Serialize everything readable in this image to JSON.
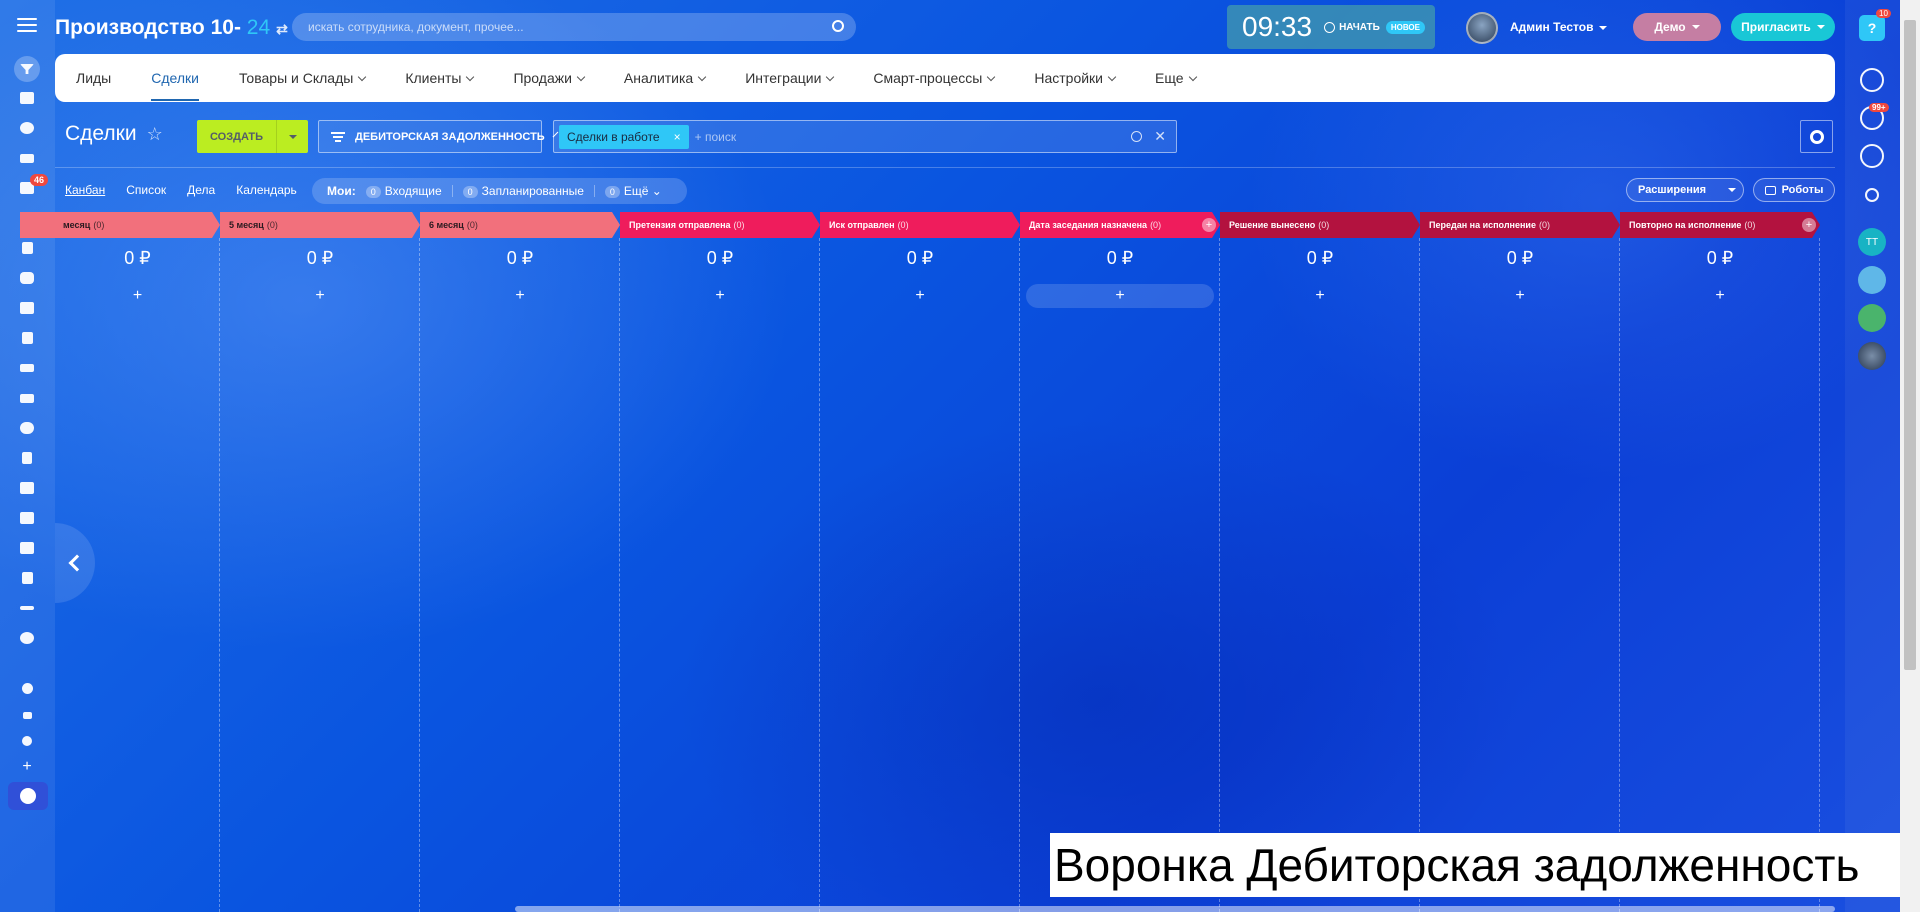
{
  "portal": {
    "title": "Производство 10-",
    "number": "24",
    "swap_icon": "⇄"
  },
  "search": {
    "placeholder": "искать сотрудника, документ, прочее..."
  },
  "timeman": {
    "time": "09:33",
    "start_label": "НАЧАТЬ",
    "new_badge": "НОВОЕ"
  },
  "user": {
    "name": "Админ Тестов"
  },
  "demo_label": "Демо",
  "invite_label": "Пригласить",
  "left_sidebar": {
    "badge": "46"
  },
  "right_sidebar": {
    "help_badge": "10",
    "bell_badge": "99+",
    "tt_label": "TT"
  },
  "nav": {
    "items": [
      {
        "label": "Лиды",
        "has_menu": false,
        "active": false
      },
      {
        "label": "Сделки",
        "has_menu": false,
        "active": true
      },
      {
        "label": "Товары и Склады",
        "has_menu": true,
        "active": false
      },
      {
        "label": "Клиенты",
        "has_menu": true,
        "active": false
      },
      {
        "label": "Продажи",
        "has_menu": true,
        "active": false
      },
      {
        "label": "Аналитика",
        "has_menu": true,
        "active": false
      },
      {
        "label": "Интеграции",
        "has_menu": true,
        "active": false
      },
      {
        "label": "Смарт-процессы",
        "has_menu": true,
        "active": false
      },
      {
        "label": "Настройки",
        "has_menu": true,
        "active": false
      },
      {
        "label": "Еще",
        "has_menu": true,
        "active": false
      }
    ]
  },
  "toolbar": {
    "page_title": "Сделки",
    "create_label": "СОЗДАТЬ",
    "funnel_label": "ДЕБИТОРСКАЯ ЗАДОЛЖЕННОСТЬ",
    "filter_chip": "Сделки в работе",
    "filter_placeholder": "+ поиск"
  },
  "views": {
    "items": [
      "Канбан",
      "Список",
      "Дела",
      "Календарь"
    ],
    "mine_label": "Мои:",
    "incoming": {
      "count": "0",
      "label": "Входящие"
    },
    "planned": {
      "count": "0",
      "label": "Запланированные"
    },
    "more": {
      "count": "0",
      "label": "Ещё"
    },
    "extensions_label": "Расширения",
    "robots_label": "Роботы"
  },
  "kanban": {
    "columns": [
      {
        "title": "месяц",
        "count": "(0)",
        "sum": "0 ₽",
        "color": "#f2707c",
        "dark_text": true
      },
      {
        "title": "5 месяц",
        "count": "(0)",
        "sum": "0 ₽",
        "color": "#f2707c",
        "dark_text": true
      },
      {
        "title": "6 месяц",
        "count": "(0)",
        "sum": "0 ₽",
        "color": "#f2707c",
        "dark_text": true
      },
      {
        "title": "Претензия отправлена",
        "count": "(0)",
        "sum": "0 ₽",
        "color": "#ef1c5c",
        "dark_text": false
      },
      {
        "title": "Иск отправлен",
        "count": "(0)",
        "sum": "0 ₽",
        "color": "#ef1c5c",
        "dark_text": false
      },
      {
        "title": "Дата заседания назначена",
        "count": "(0)",
        "sum": "0 ₽",
        "color": "#ef1c5c",
        "dark_text": false
      },
      {
        "title": "Решение вынесено",
        "count": "(0)",
        "sum": "0 ₽",
        "color": "#b3123f",
        "dark_text": false
      },
      {
        "title": "Передан на исполнение",
        "count": "(0)",
        "sum": "0 ₽",
        "color": "#b3123f",
        "dark_text": false
      },
      {
        "title": "Повторно на исполнение",
        "count": "(0)",
        "sum": "0 ₽",
        "color": "#b3123f",
        "dark_text": false
      }
    ]
  },
  "caption": "Воронка Дебиторская задолженность"
}
